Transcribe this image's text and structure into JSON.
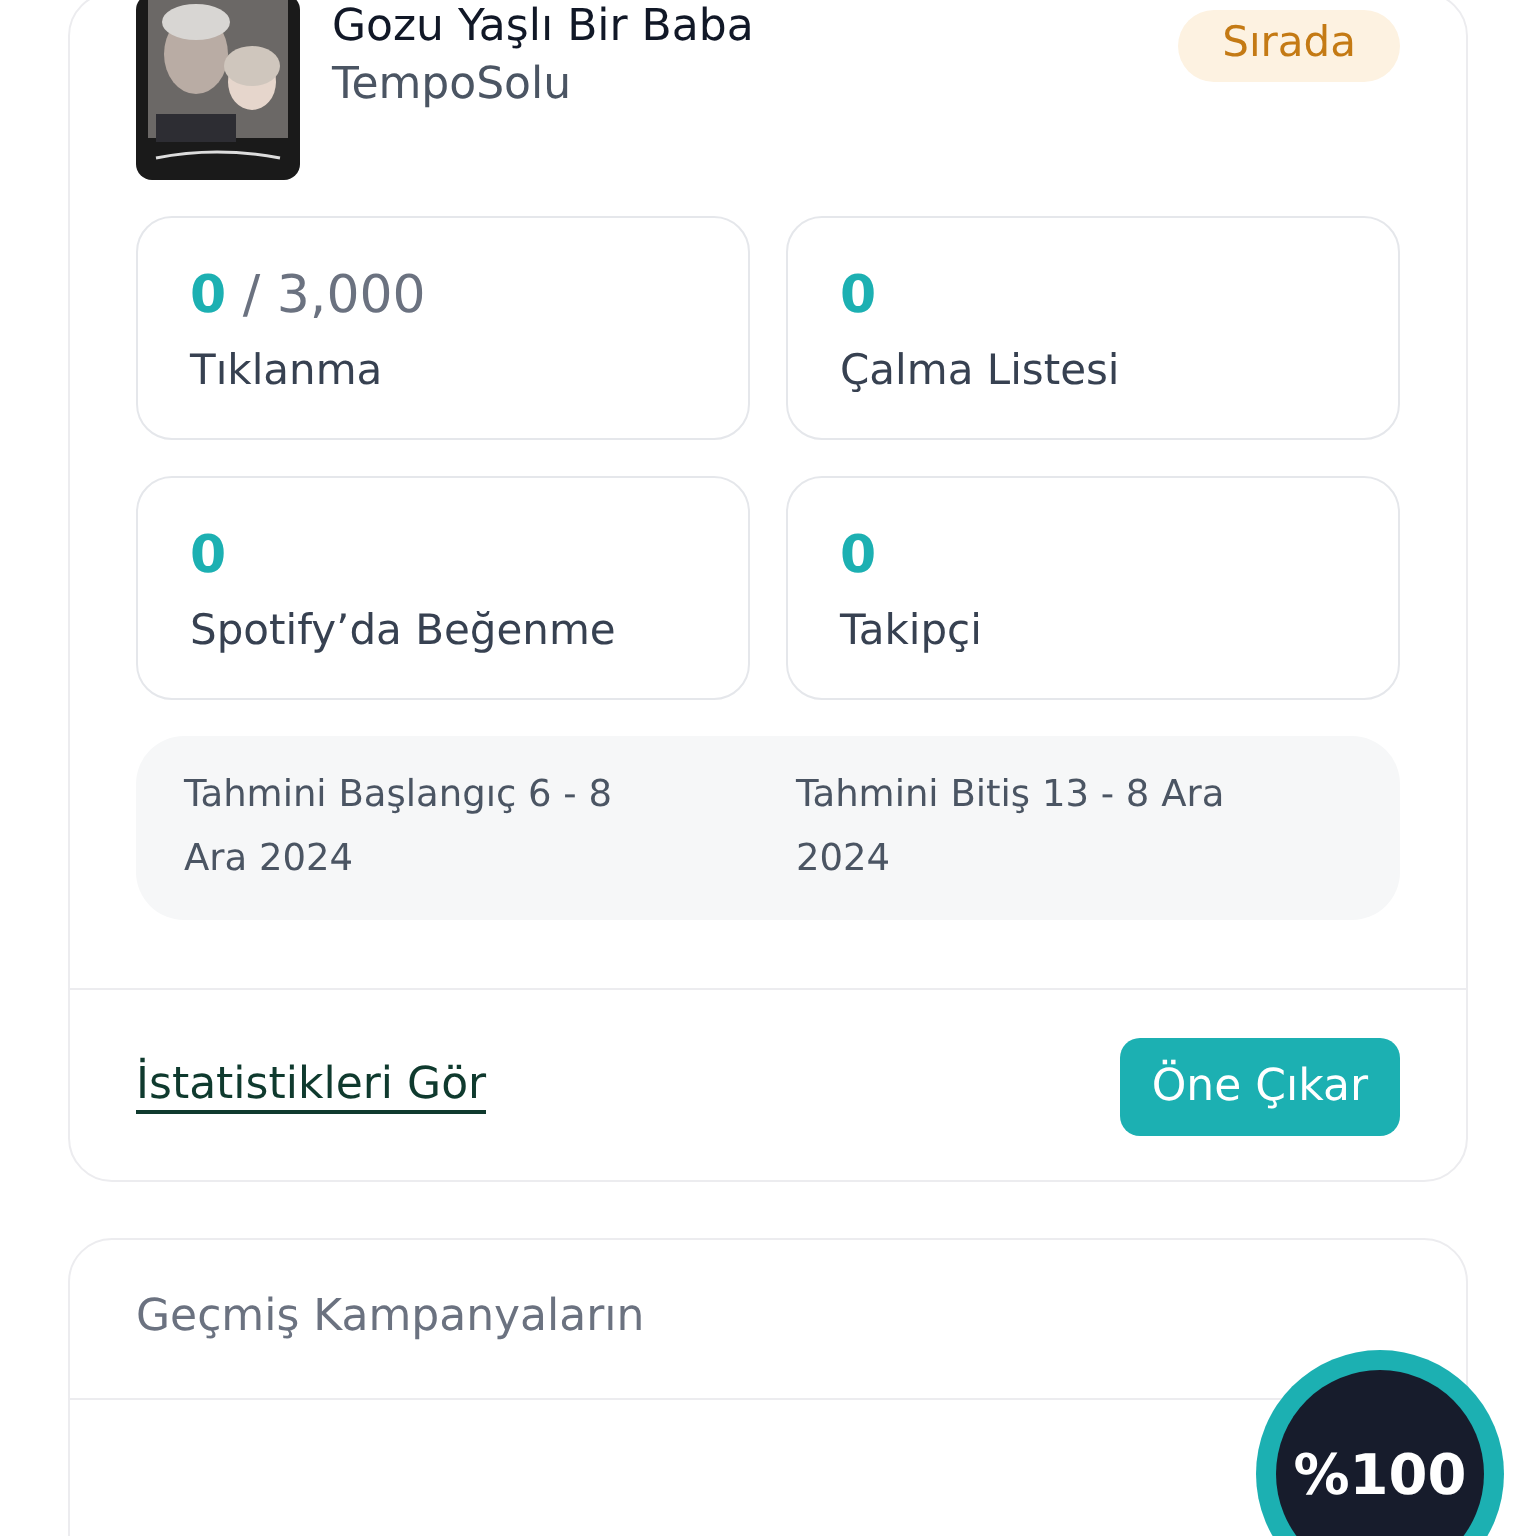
{
  "campaign": {
    "title": "Gozu Yaşlı Bir Baba",
    "artist": "TempoSolu",
    "status": "Sırada",
    "stats": [
      {
        "value": "0",
        "target": "/ 3,000",
        "label": "Tıklanma"
      },
      {
        "value": "0",
        "label": "Çalma Listesi"
      },
      {
        "value": "0",
        "label": "Spotify’da Beğenme"
      },
      {
        "value": "0",
        "label": "Takipçi"
      }
    ],
    "start": "Tahmini Başlangıç 6 - 8 Ara 2024",
    "end": "Tahmini Bitiş 13 - 8 Ara 2024",
    "stats_link": "İstatistikleri Gör",
    "promote_button": "Öne Çıkar"
  },
  "past": {
    "title": "Geçmiş Kampanyaların"
  },
  "progress": {
    "label": "%100"
  }
}
